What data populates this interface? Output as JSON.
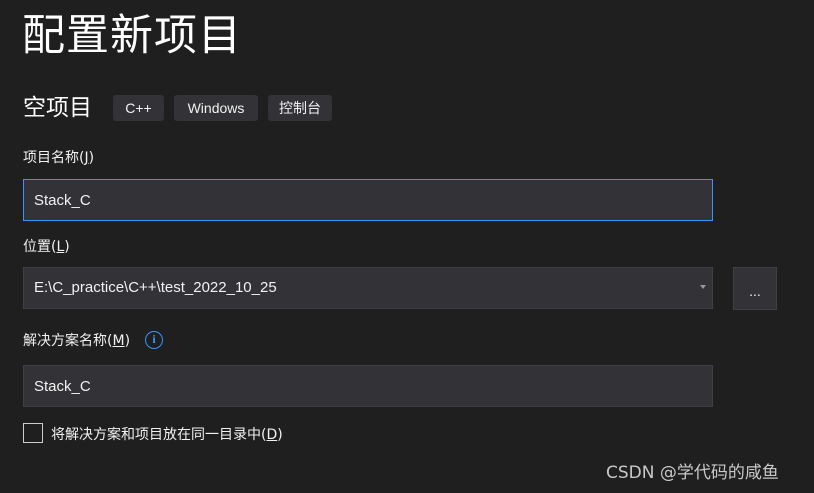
{
  "page": {
    "title": "配置新项目",
    "template_name": "空项目",
    "tags": [
      "C++",
      "Windows",
      "控制台"
    ]
  },
  "project_name": {
    "label_text": "项目名称(",
    "label_key": "J",
    "label_end": ")",
    "value": "Stack_C"
  },
  "location": {
    "label_text": "位置(",
    "label_key": "L",
    "label_end": ")",
    "value": "E:\\C_practice\\C++\\test_2022_10_25",
    "browse_label": "..."
  },
  "solution_name": {
    "label_text": "解决方案名称(",
    "label_key": "M",
    "label_end": ")",
    "info_icon_glyph": "i",
    "value": "Stack_C"
  },
  "same_directory": {
    "label_text": "将解决方案和项目放在同一目录中(",
    "label_key": "D",
    "label_end": ")",
    "checked": false
  },
  "watermark": "CSDN @学代码的咸鱼",
  "colors": {
    "background": "#1f1f1f",
    "input_background": "#333337",
    "focus_border": "#3794ff",
    "accent": "#3794ff"
  },
  "icons": {
    "info": "info-icon",
    "combo": "chevron-down-icon",
    "checkbox": "checkbox-icon"
  }
}
